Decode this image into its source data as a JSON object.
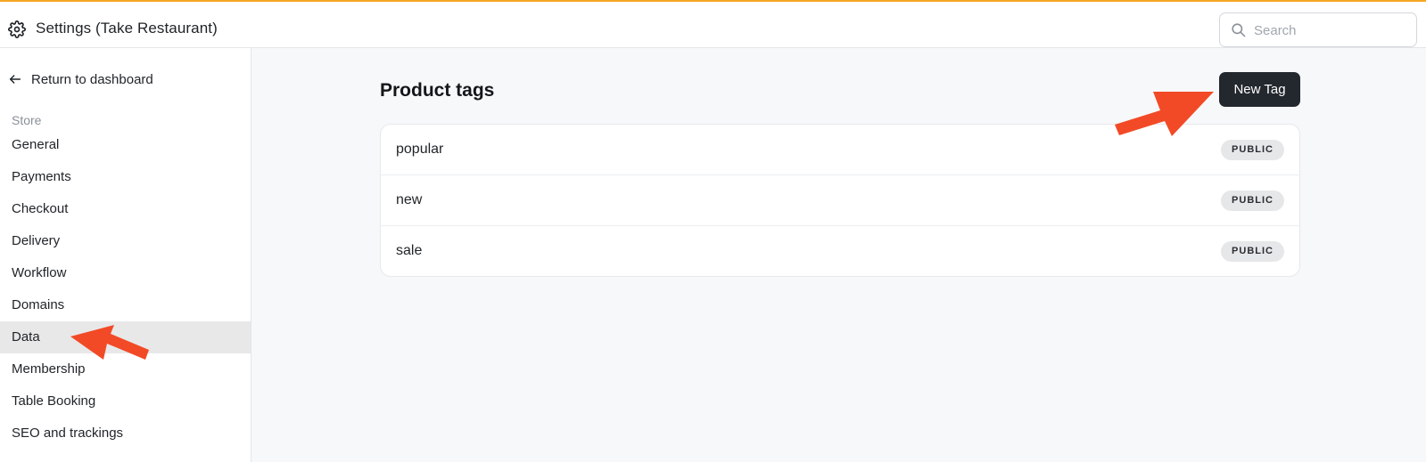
{
  "header": {
    "title": "Settings (Take Restaurant)",
    "icon": "gear-icon",
    "accent_color": "#f5a623",
    "search": {
      "placeholder": "Search",
      "value": ""
    }
  },
  "sidebar": {
    "back_label": "Return to dashboard",
    "section_label": "Store",
    "items": [
      {
        "label": "General"
      },
      {
        "label": "Payments"
      },
      {
        "label": "Checkout"
      },
      {
        "label": "Delivery"
      },
      {
        "label": "Workflow"
      },
      {
        "label": "Domains"
      },
      {
        "label": "Data",
        "active": true
      },
      {
        "label": "Membership"
      },
      {
        "label": "Table Booking"
      },
      {
        "label": "SEO and trackings"
      }
    ]
  },
  "main": {
    "title": "Product tags",
    "new_button_label": "New Tag",
    "tags": [
      {
        "name": "popular",
        "visibility": "PUBLIC"
      },
      {
        "name": "new",
        "visibility": "PUBLIC"
      },
      {
        "name": "sale",
        "visibility": "PUBLIC"
      }
    ]
  },
  "annotations": {
    "arrow_color": "#f24a26"
  }
}
